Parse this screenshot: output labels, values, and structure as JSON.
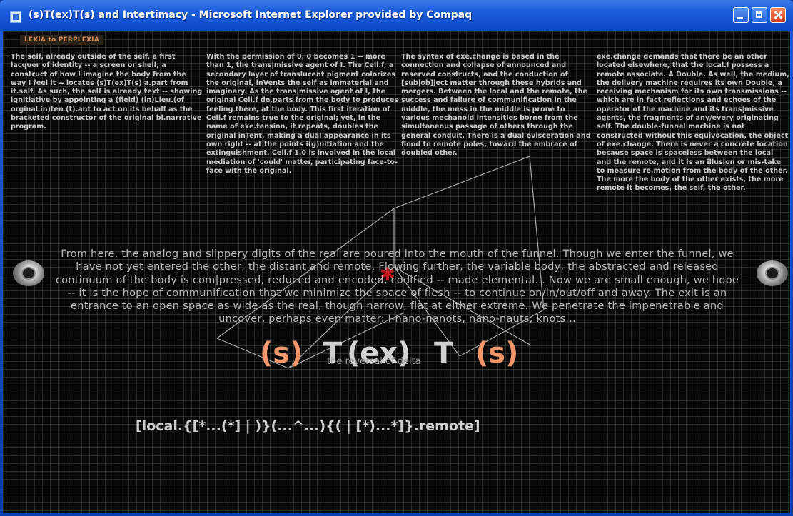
{
  "window": {
    "title": "(s)T(ex)T(s) and Intertimacy - Microsoft Internet Explorer provided by Compaq"
  },
  "page": {
    "tab_label": "LEXIA to PERPLEXIA",
    "columns": [
      "The self, already outside of the self, a first lacquer of identity -- a screen or shell, a construct of how I imagine the body from the way I feel it -- locates (s)T(ex)T(s) a.part from it.self. As such, the self is already text -- showing ignitiative by appointing a (field) (in)Lieu.(of orginal in)ten (t).ant to act on its behalf as the bracketed constructor of the original bi.narrative program.",
      "With the permission of 0, 0 becomes 1 -- more than 1, the trans|missive agent of I. The Cell.f, a secondary layer of translucent pigment colorizes the original, inVents the self as immaterial and imaginary. As the trans|missive agent of I, the original Cell.f de.parts from the body to produces feeling there, at the body. This first iteration of Cell.f remains true to the original; yet, in the name of exe.tension, it repeats, doubles the original inTent, making a dual appearance in its own right -- at the points i(g)nitiation and the extinguishment. Cell.f 1.0 is involved in the local mediation of 'could' matter, participating face-to-face with the original.",
      "The syntax of exe.change is based in the connection and collapse of announced and reserved constructs, and the conduction of [sub|ob]ject matter through these hybrids and mergers. Between the local and the remote, the success and failure of communification in the middle, the mess in the middle is prone to various mechanoid intensities borne from the simultaneous passage of others through the general conduit. There is a dual evisceration and flood to remote poles, toward the embrace of doubled other.",
      "exe.change demands that there be an other located elsewhere, that the local.I possess a remote associate. A Double. As well, the medium, the delivery machine requires its own Double, a receiving mechanism for its own transmissions -- which are in fact reflections and echoes of the operator of the machine and its trans|missive agents, the fragments of any/every originating self. The double-funnel machine is not constructed without this equivocation, the object of exe.change. There is never a concrete location because space is spaceless between the local and the remote, and it is an illusion or mis-take to measure re.motion from the body of the other. The more the body of the other exists, the more remote it becomes, the self, the other."
    ],
    "overlay_text": "From here, the analog and slippery digits of the real are poured into the mouth of the funnel. Though we enter the funnel, we have not yet entered the other, the distant and remote. Flowing further, the variable body, the abstracted and released continuum of the body is com|pressed, reduced and encoded, codified -- made elemental... Now we are small enough, we hope -- it is the hope of communification that we minimize the space of flesh -- to continue on/in/out/off and away. The exit is an entrance to an open space as wide as the real, though narrow, flat at either extreme. We penetrate the impenetrable and uncover, perhaps even matter: I-nano-nanots, nano-nauts, knots...",
    "logo": {
      "p1": "(s)",
      "t1": "T",
      "ex": "(ex)",
      "t2": "T",
      "p2": "(s)"
    },
    "subtitle": "the reversal of delta",
    "code": "[local.{[*...(*] | )}(...^...){( | [*)...*]}.remote]",
    "accent_color": "#f1956a",
    "star_glyph": "✱"
  }
}
